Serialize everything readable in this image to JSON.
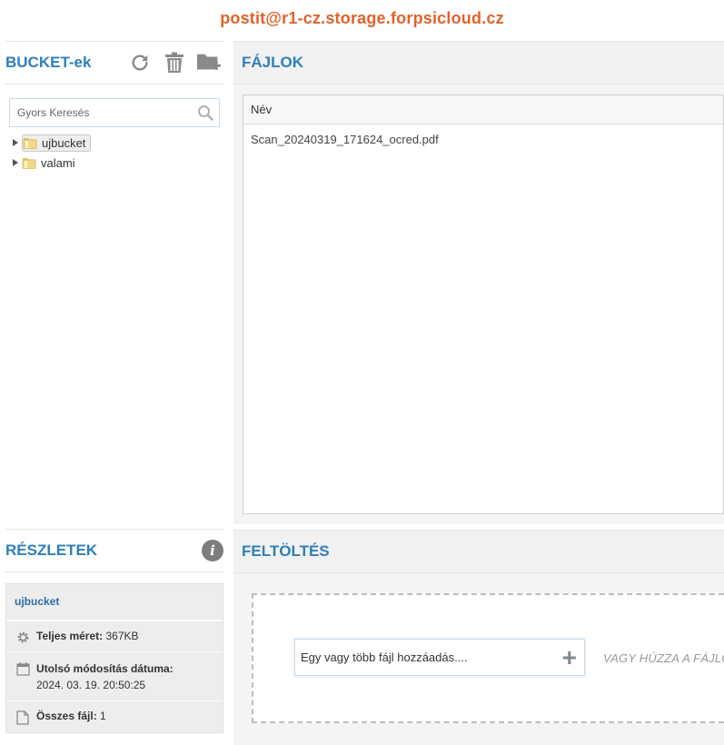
{
  "account": "postit@r1-cz.storage.forpsicloud.cz",
  "buckets": {
    "title": "BUCKET-ek",
    "icons": [
      "refresh-icon",
      "trash-icon",
      "add-folder-icon"
    ],
    "search_placeholder": "Gyors Keresés",
    "items": [
      {
        "label": "ujbucket",
        "selected": true
      },
      {
        "label": "valami",
        "selected": false
      }
    ]
  },
  "files": {
    "title": "FÁJLOK",
    "column_name": "Név",
    "rows": [
      {
        "name": "Scan_20240319_171624_ocred.pdf"
      }
    ]
  },
  "details": {
    "title": "RÉSZLETEK",
    "bucket_name": "ujbucket",
    "size_label": "Teljes méret:",
    "size_value": "367KB",
    "modified_label": "Utolsó módosítás dátuma:",
    "modified_value": "2024. 03. 19. 20:50:25",
    "count_label": "Összes fájl:",
    "count_value": "1"
  },
  "upload": {
    "title": "FELTÖLTÉS",
    "add_label": "Egy vagy több fájl hozzáadás....",
    "drag_text": "VAGY HÚZZA A FÁJLOK"
  },
  "colors": {
    "accent": "#2e7fb8",
    "account": "#e0622b"
  }
}
